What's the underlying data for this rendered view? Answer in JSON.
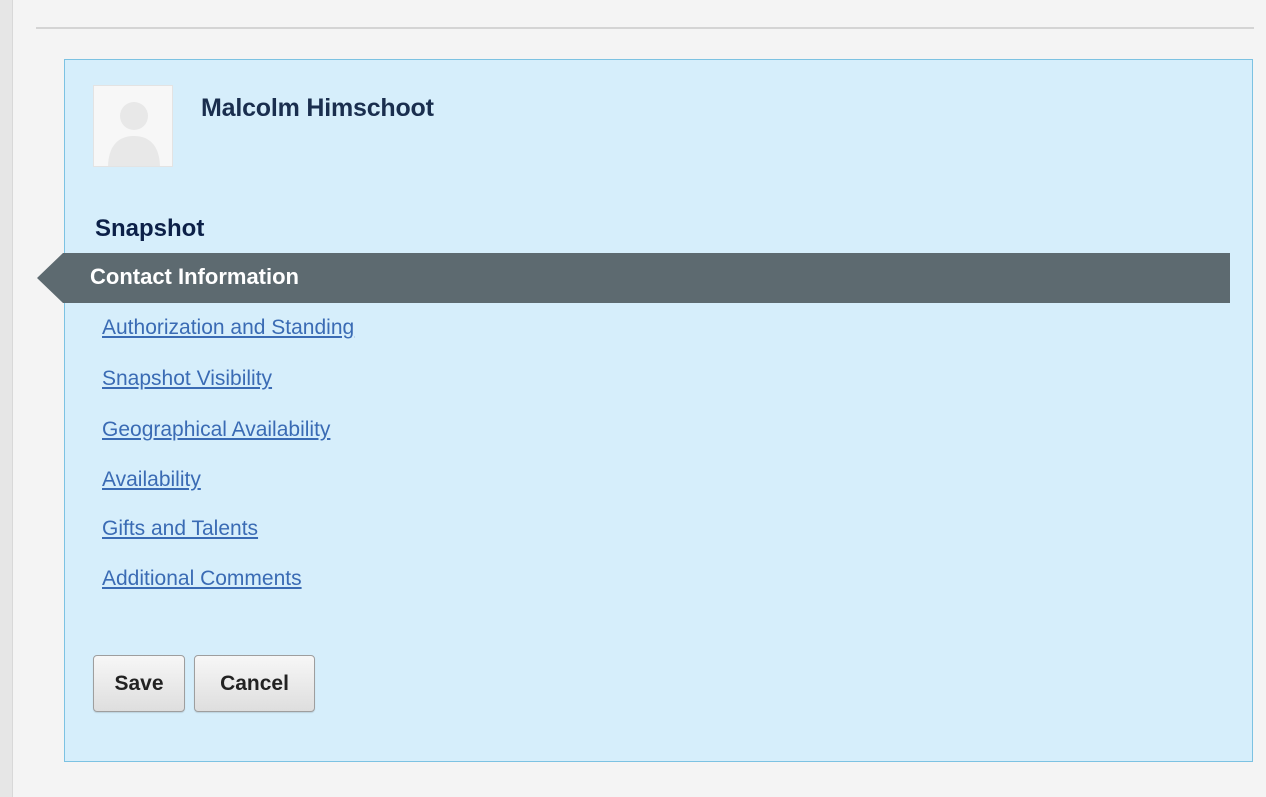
{
  "profile": {
    "name": "Malcolm Himschoot",
    "avatar_icon": "default-person-silhouette-icon"
  },
  "section": {
    "title": "Snapshot"
  },
  "nav": {
    "active": "Contact Information",
    "items": [
      "Authorization and Standing",
      "Snapshot Visibility",
      "Geographical Availability",
      "Availability",
      "Gifts and Talents",
      "Additional Comments"
    ]
  },
  "actions": {
    "save_label": "Save",
    "cancel_label": "Cancel"
  },
  "colors": {
    "panel_background": "#d6eefb",
    "panel_border": "#7cc2e2",
    "active_bar": "#5d6a70",
    "link": "#3a6bb4",
    "heading": "#0c2048"
  }
}
